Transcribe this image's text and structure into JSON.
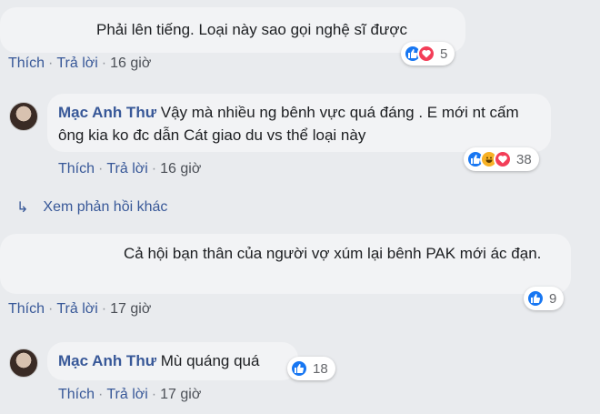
{
  "comments": [
    {
      "name": "",
      "text": "Phải lên tiếng. Loại này sao gọi nghệ sĩ được",
      "actions": {
        "like": "Thích",
        "reply": "Trả lời",
        "time": "16 giờ"
      },
      "reactions": {
        "icons": [
          "like-icon",
          "love-icon"
        ],
        "count": "5"
      }
    },
    {
      "name": "Mạc Anh Thư",
      "text": "Vậy mà nhiều ng bênh vực quá đáng . E mới nt cấm ông kia ko đc dẫn Cát giao du vs thể loại này",
      "actions": {
        "like": "Thích",
        "reply": "Trả lời",
        "time": "16 giờ"
      },
      "reactions": {
        "icons": [
          "like-icon",
          "haha-icon",
          "love-icon"
        ],
        "count": "38"
      }
    },
    {
      "name": "",
      "text": "Cả hội bạn thân của người vợ xúm lại bênh PAK mới ác đạn.",
      "actions": {
        "like": "Thích",
        "reply": "Trả lời",
        "time": "17 giờ"
      },
      "reactions": {
        "icons": [
          "like-icon"
        ],
        "count": "9"
      }
    },
    {
      "name": "Mạc Anh Thư",
      "text": "Mù quáng quá",
      "actions": {
        "like": "Thích",
        "reply": "Trả lời",
        "time": "17 giờ"
      },
      "reactions": {
        "icons": [
          "like-icon"
        ],
        "count": "18"
      }
    }
  ],
  "more_replies": {
    "icon": "reply-arrow-icon",
    "label": "Xem phản hồi khác"
  },
  "sep": "·",
  "colors": {
    "link": "#385898",
    "bubble": "#f2f3f5",
    "background": "#e9ebee",
    "like": "#1877f2",
    "love": "#f33e58",
    "haha": "#f7b125"
  }
}
